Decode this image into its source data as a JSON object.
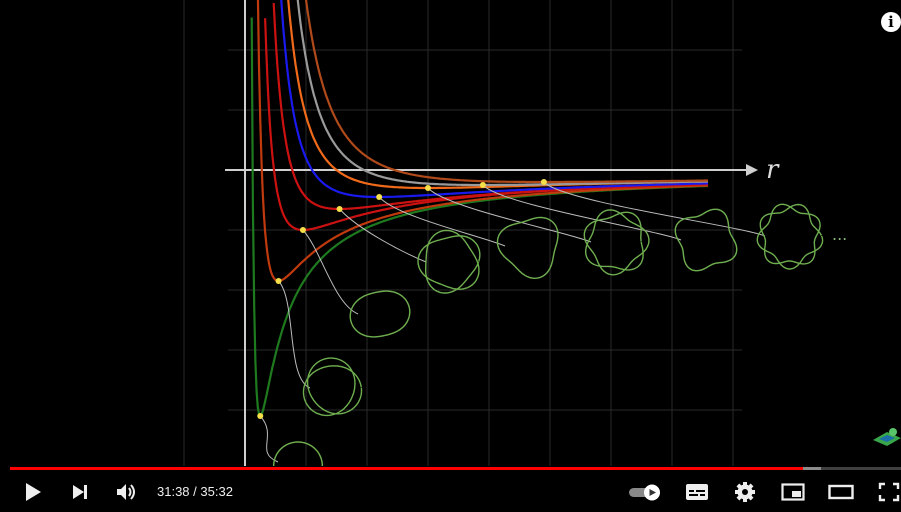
{
  "player": {
    "time_current": "31:38",
    "time_separator": " / ",
    "time_total": "35:32",
    "progress_fraction": 0.89,
    "buffer_fraction": 0.91,
    "info_label": "i",
    "accent_color": "#ff0000"
  },
  "icons": {
    "play": "play-icon",
    "next": "next-icon",
    "volume": "volume-icon",
    "autoplay": "autoplay-toggle-icon",
    "subtitles": "subtitles-icon",
    "settings": "gear-icon",
    "miniplayer": "miniplayer-icon",
    "theater": "theater-mode-icon",
    "fullscreen": "fullscreen-icon",
    "info": "info-icon"
  },
  "figure": {
    "axis_label": "r",
    "ellipsis": "..."
  },
  "chart_data": {
    "type": "line",
    "title": "",
    "xlabel": "r",
    "ylabel": "",
    "grid": true,
    "series": [
      {
        "color": "#1e7a1e",
        "min_point": [
          0.25,
          -4.1
        ]
      },
      {
        "color": "#c03a0e",
        "min_point": [
          0.55,
          -1.85
        ]
      },
      {
        "color": "#cc1111",
        "min_point": [
          0.95,
          -1.0
        ]
      },
      {
        "color": "#cc1111",
        "min_point": [
          1.55,
          -0.65
        ]
      },
      {
        "color": "#1a1aee",
        "min_point": [
          2.2,
          -0.45
        ]
      },
      {
        "color": "#f06a1a",
        "min_point": [
          3.0,
          -0.3
        ]
      },
      {
        "color": "#9a9a9a",
        "min_point": [
          3.9,
          -0.25
        ]
      },
      {
        "color": "#b04a1a",
        "min_point": [
          4.9,
          -0.2
        ]
      }
    ]
  }
}
